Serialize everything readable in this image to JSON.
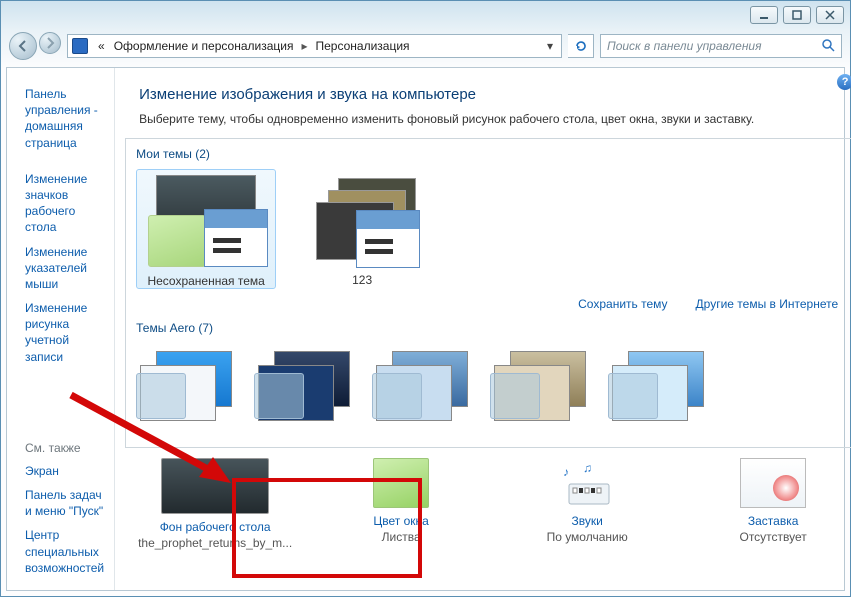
{
  "breadcrumbs": {
    "prefix": "«",
    "item1": "Оформление и персонализация",
    "item2": "Персонализация"
  },
  "search": {
    "placeholder": "Поиск в панели управления"
  },
  "sidebar": {
    "links": [
      "Панель управления - домашняя страница",
      "Изменение значков рабочего стола",
      "Изменение указателей мыши",
      "Изменение рисунка учетной записи"
    ],
    "see_also_hdr": "См. также",
    "see_also": [
      "Экран",
      "Панель задач и меню \"Пуск\"",
      "Центр специальных возможностей"
    ]
  },
  "main": {
    "title": "Изменение изображения и звука на компьютере",
    "desc": "Выберите тему, чтобы одновременно изменить фоновый рисунок рабочего стола, цвет окна, звуки и заставку."
  },
  "groups": {
    "my_themes_label": "Мои темы (2)",
    "my_themes": [
      {
        "name": "Несохраненная тема"
      },
      {
        "name": "123"
      }
    ],
    "save_link": "Сохранить тему",
    "more_link": "Другие темы в Интернете",
    "aero_label": "Темы Aero (7)"
  },
  "settings": {
    "background": {
      "link": "Фон рабочего стола",
      "value": "the_prophet_returns_by_m..."
    },
    "color": {
      "link": "Цвет окна",
      "value": "Листва"
    },
    "sounds": {
      "link": "Звуки",
      "value": "По умолчанию"
    },
    "screensaver": {
      "link": "Заставка",
      "value": "Отсутствует"
    }
  }
}
